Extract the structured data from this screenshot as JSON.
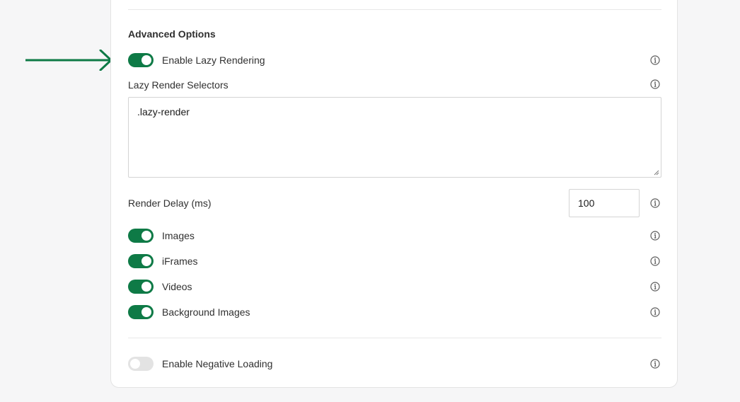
{
  "section": {
    "title": "Advanced Options"
  },
  "lazy_rendering": {
    "label": "Enable Lazy Rendering",
    "enabled": true
  },
  "selectors": {
    "label": "Lazy Render Selectors",
    "value": ".lazy-render"
  },
  "render_delay": {
    "label": "Render Delay (ms)",
    "value": "100"
  },
  "media_toggles": [
    {
      "label": "Images",
      "enabled": true
    },
    {
      "label": "iFrames",
      "enabled": true
    },
    {
      "label": "Videos",
      "enabled": true
    },
    {
      "label": "Background Images",
      "enabled": true
    }
  ],
  "negative_loading": {
    "label": "Enable Negative Loading",
    "enabled": false
  },
  "colors": {
    "accent": "#0e7a46",
    "toggle_off": "#e3e3e3",
    "arrow": "#0e7a46"
  },
  "icons": {
    "info": "info-circle-icon",
    "pointer": "arrow-right-icon"
  }
}
